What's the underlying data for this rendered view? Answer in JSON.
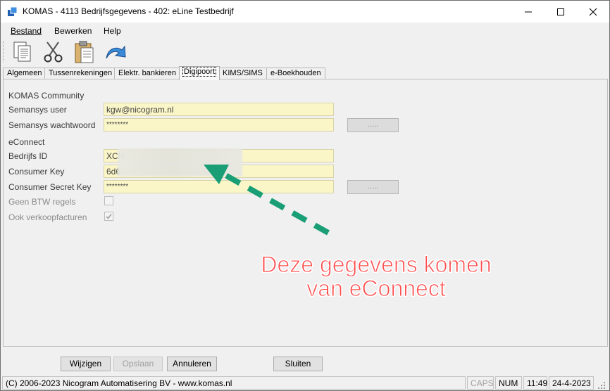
{
  "window": {
    "title": "KOMAS - 4113 Bedrijfsgegevens - 402: eLine Testbedrijf"
  },
  "menu": {
    "items": [
      {
        "label": "Bestand"
      },
      {
        "label": "Bewerken"
      },
      {
        "label": "Help"
      }
    ]
  },
  "toolbar": {
    "icons": [
      "new-document-icon",
      "cut-icon",
      "paste-icon",
      "undo-icon"
    ]
  },
  "tabs": [
    {
      "label": "Algemeen"
    },
    {
      "label": "Tussenrekeningen"
    },
    {
      "label": "Elektr. bankieren"
    },
    {
      "label": "Digipoort",
      "active": true
    },
    {
      "label": "KIMS/SIMS"
    },
    {
      "label": "e-Boekhouden"
    }
  ],
  "form": {
    "section_community": "KOMAS Community",
    "semansys_user_label": "Semansys user",
    "semansys_user_value": "kgw@nicogram.nl",
    "semansys_password_label": "Semansys wachtwoord",
    "semansys_password_value": "********",
    "section_econnect": "eConnect",
    "bedrijfs_id_label": "Bedrijfs ID",
    "bedrijfs_id_value": "XCN",
    "consumer_key_label": "Consumer Key",
    "consumer_key_value": "6d6",
    "consumer_secret_label": "Consumer Secret Key",
    "consumer_secret_value": "********",
    "geen_btw_label": "Geen BTW regels",
    "geen_btw_checked": false,
    "ook_verkoop_label": "Ook verkoopfacturen",
    "ook_verkoop_checked": true,
    "ellipsis_label": "....."
  },
  "annotation": {
    "line1": "Deze gegevens komen",
    "line2": "van eConnect",
    "color": "#ff4d4d",
    "arrow_color": "#1a9e76"
  },
  "buttons": {
    "wijzigen": "Wijzigen",
    "opslaan": "Opslaan",
    "annuleren": "Annuleren",
    "sluiten": "Sluiten"
  },
  "status": {
    "copyright": "(C) 2006-2023 Nicogram Automatisering BV - www.komas.nl",
    "caps": "CAPS",
    "num": "NUM",
    "time": "11:49",
    "date": "24-4-2023"
  }
}
